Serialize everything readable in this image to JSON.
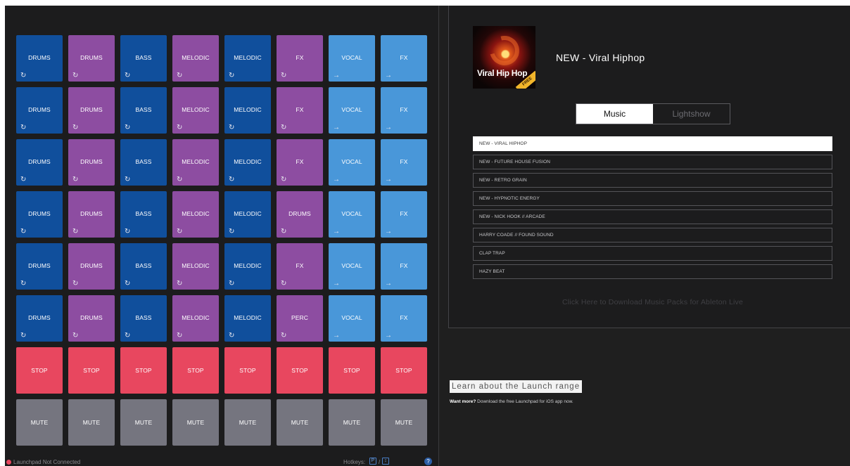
{
  "colors": {
    "drums_blue": "#104f9c",
    "drums_purple": "#8d4da1",
    "vocal_light_blue": "#4997d9",
    "stop_red": "#e8475f",
    "mute_gray": "#75757f"
  },
  "pads": [
    [
      {
        "label": "DRUMS",
        "color": "#104f9c",
        "icon": "↻"
      },
      {
        "label": "DRUMS",
        "color": "#8d4da1",
        "icon": "↻"
      },
      {
        "label": "BASS",
        "color": "#104f9c",
        "icon": "↻"
      },
      {
        "label": "MELODIC",
        "color": "#8d4da1",
        "icon": "↻"
      },
      {
        "label": "MELODIC",
        "color": "#104f9c",
        "icon": "↻"
      },
      {
        "label": "FX",
        "color": "#8d4da1",
        "icon": "↻"
      },
      {
        "label": "VOCAL",
        "color": "#4997d9",
        "icon": "→"
      },
      {
        "label": "FX",
        "color": "#4997d9",
        "icon": "→"
      }
    ],
    [
      {
        "label": "DRUMS",
        "color": "#104f9c",
        "icon": "↻"
      },
      {
        "label": "DRUMS",
        "color": "#8d4da1",
        "icon": "↻"
      },
      {
        "label": "BASS",
        "color": "#104f9c",
        "icon": "↻"
      },
      {
        "label": "MELODIC",
        "color": "#8d4da1",
        "icon": "↻"
      },
      {
        "label": "MELODIC",
        "color": "#104f9c",
        "icon": "↻"
      },
      {
        "label": "FX",
        "color": "#8d4da1",
        "icon": "↻"
      },
      {
        "label": "VOCAL",
        "color": "#4997d9",
        "icon": "→"
      },
      {
        "label": "FX",
        "color": "#4997d9",
        "icon": "→"
      }
    ],
    [
      {
        "label": "DRUMS",
        "color": "#104f9c",
        "icon": "↻"
      },
      {
        "label": "DRUMS",
        "color": "#8d4da1",
        "icon": "↻"
      },
      {
        "label": "BASS",
        "color": "#104f9c",
        "icon": "↻"
      },
      {
        "label": "MELODIC",
        "color": "#8d4da1",
        "icon": "↻"
      },
      {
        "label": "MELODIC",
        "color": "#104f9c",
        "icon": "↻"
      },
      {
        "label": "FX",
        "color": "#8d4da1",
        "icon": "↻"
      },
      {
        "label": "VOCAL",
        "color": "#4997d9",
        "icon": "→"
      },
      {
        "label": "FX",
        "color": "#4997d9",
        "icon": "→"
      }
    ],
    [
      {
        "label": "DRUMS",
        "color": "#104f9c",
        "icon": "↻"
      },
      {
        "label": "DRUMS",
        "color": "#8d4da1",
        "icon": "↻"
      },
      {
        "label": "BASS",
        "color": "#104f9c",
        "icon": "↻"
      },
      {
        "label": "MELODIC",
        "color": "#8d4da1",
        "icon": "↻"
      },
      {
        "label": "MELODIC",
        "color": "#104f9c",
        "icon": "↻"
      },
      {
        "label": "DRUMS",
        "color": "#8d4da1",
        "icon": "↻"
      },
      {
        "label": "VOCAL",
        "color": "#4997d9",
        "icon": "→"
      },
      {
        "label": "FX",
        "color": "#4997d9",
        "icon": "→"
      }
    ],
    [
      {
        "label": "DRUMS",
        "color": "#104f9c",
        "icon": "↻"
      },
      {
        "label": "DRUMS",
        "color": "#8d4da1",
        "icon": "↻"
      },
      {
        "label": "BASS",
        "color": "#104f9c",
        "icon": "↻"
      },
      {
        "label": "MELODIC",
        "color": "#8d4da1",
        "icon": "↻"
      },
      {
        "label": "MELODIC",
        "color": "#104f9c",
        "icon": "↻"
      },
      {
        "label": "FX",
        "color": "#8d4da1",
        "icon": "↻"
      },
      {
        "label": "VOCAL",
        "color": "#4997d9",
        "icon": "→"
      },
      {
        "label": "FX",
        "color": "#4997d9",
        "icon": "→"
      }
    ],
    [
      {
        "label": "DRUMS",
        "color": "#104f9c",
        "icon": "↻"
      },
      {
        "label": "DRUMS",
        "color": "#8d4da1",
        "icon": "↻"
      },
      {
        "label": "BASS",
        "color": "#104f9c",
        "icon": "↻"
      },
      {
        "label": "MELODIC",
        "color": "#8d4da1",
        "icon": "↻"
      },
      {
        "label": "MELODIC",
        "color": "#104f9c",
        "icon": "↻"
      },
      {
        "label": "PERC",
        "color": "#8d4da1",
        "icon": "↻"
      },
      {
        "label": "VOCAL",
        "color": "#4997d9",
        "icon": "→"
      },
      {
        "label": "FX",
        "color": "#4997d9",
        "icon": "→"
      }
    ],
    [
      {
        "label": "STOP",
        "color": "#e8475f",
        "icon": ""
      },
      {
        "label": "STOP",
        "color": "#e8475f",
        "icon": ""
      },
      {
        "label": "STOP",
        "color": "#e8475f",
        "icon": ""
      },
      {
        "label": "STOP",
        "color": "#e8475f",
        "icon": ""
      },
      {
        "label": "STOP",
        "color": "#e8475f",
        "icon": ""
      },
      {
        "label": "STOP",
        "color": "#e8475f",
        "icon": ""
      },
      {
        "label": "STOP",
        "color": "#e8475f",
        "icon": ""
      },
      {
        "label": "STOP",
        "color": "#e8475f",
        "icon": ""
      }
    ],
    [
      {
        "label": "MUTE",
        "color": "#75757f",
        "icon": ""
      },
      {
        "label": "MUTE",
        "color": "#75757f",
        "icon": ""
      },
      {
        "label": "MUTE",
        "color": "#75757f",
        "icon": ""
      },
      {
        "label": "MUTE",
        "color": "#75757f",
        "icon": ""
      },
      {
        "label": "MUTE",
        "color": "#75757f",
        "icon": ""
      },
      {
        "label": "MUTE",
        "color": "#75757f",
        "icon": ""
      },
      {
        "label": "MUTE",
        "color": "#75757f",
        "icon": ""
      },
      {
        "label": "MUTE",
        "color": "#75757f",
        "icon": ""
      }
    ]
  ],
  "status": {
    "text": "Launchpad Not Connected",
    "dot_color": "#e8475f",
    "hotkeys_label": "Hotkeys:",
    "hotkey_p": "P",
    "hotkey_sep": "/",
    "hotkey_arrow": "↕",
    "help": "?"
  },
  "pack": {
    "album_title": "Viral Hip Hop",
    "badge": "FREE",
    "title": "NEW - Viral Hiphop"
  },
  "tabs": {
    "music": "Music",
    "lightshow": "Lightshow"
  },
  "pack_list": [
    {
      "label": "NEW - VIRAL HIPHOP",
      "selected": true
    },
    {
      "label": "NEW - FUTURE HOUSE FUSION",
      "selected": false
    },
    {
      "label": "NEW - RETRO GRAIN",
      "selected": false
    },
    {
      "label": "NEW - HYPNOTIC ENERGY",
      "selected": false
    },
    {
      "label": "NEW - NICK HOOK // ARCADE",
      "selected": false
    },
    {
      "label": "HARRY COADE // FOUND SOUND",
      "selected": false
    },
    {
      "label": "CLAP TRAP",
      "selected": false
    },
    {
      "label": "HAZY BEAT",
      "selected": false
    }
  ],
  "download_link": "Click Here to Download Music Packs for Ableton Live",
  "learn_button": "Learn about the Launch range",
  "promo": {
    "bold": "Want more?",
    "text": " Download the free Launchpad for iOS app now."
  }
}
